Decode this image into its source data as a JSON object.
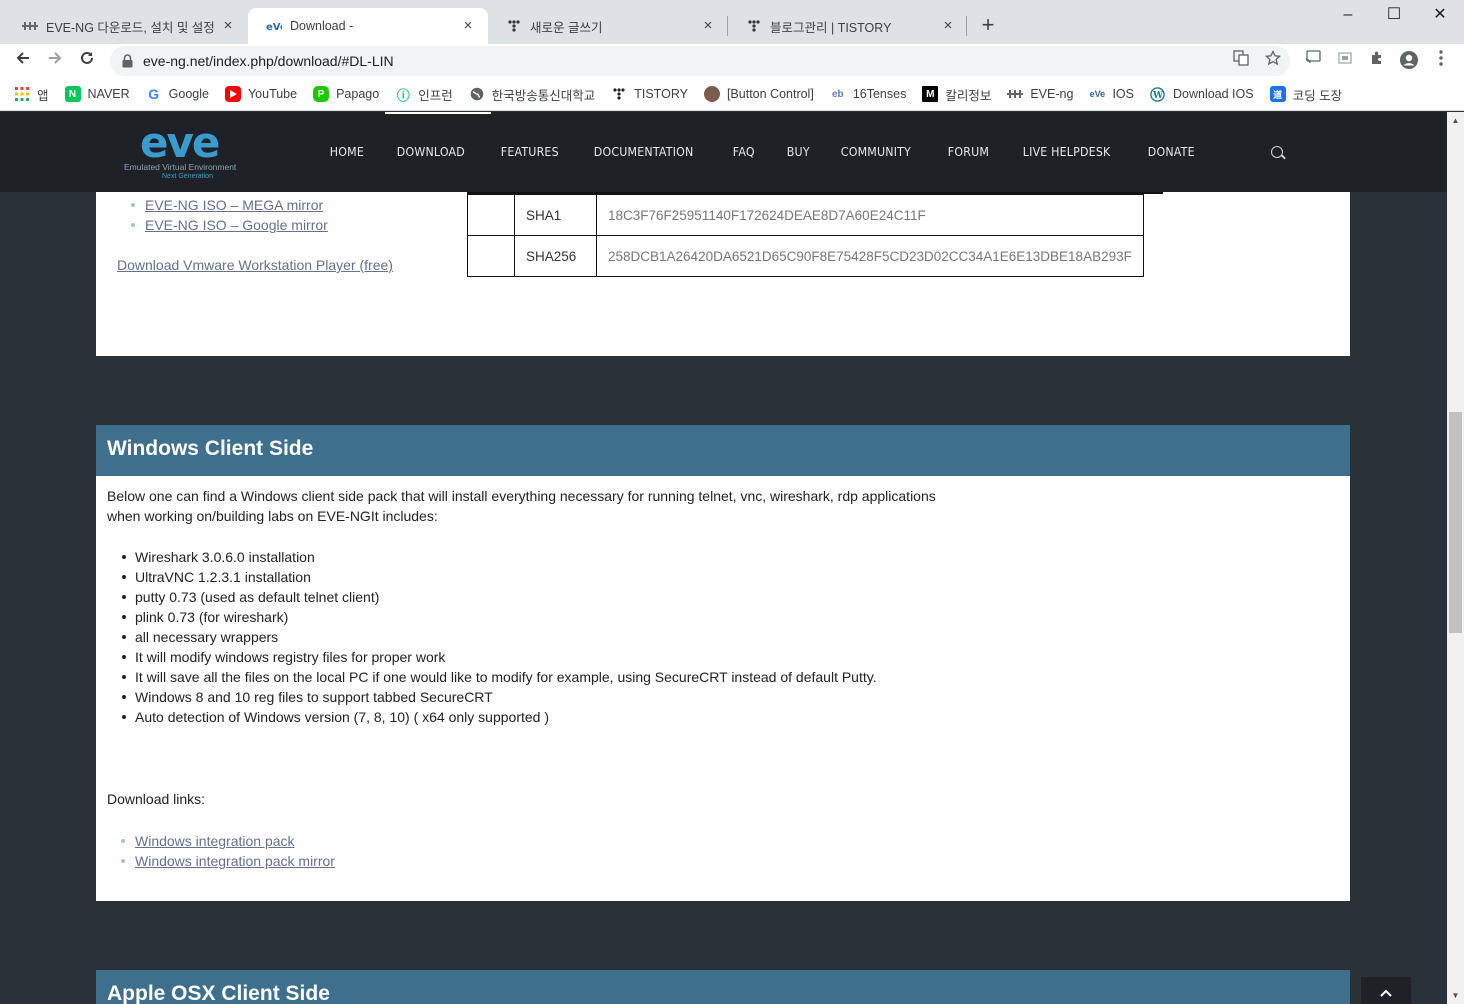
{
  "browser": {
    "tabs": [
      {
        "title": "EVE-NG 다운로드, 설치 및 설정",
        "close": "×"
      },
      {
        "title": "Download -",
        "close": "×"
      },
      {
        "title": "새로운 글쓰기",
        "close": "×"
      },
      {
        "title": "블로그관리 | TISTORY",
        "close": "×"
      }
    ],
    "newtab": "+",
    "window": {
      "minimize": "–",
      "maximize": "☐",
      "close": "✕"
    },
    "url": "eve-ng.net/index.php/download/#DL-LIN",
    "bookmarks": [
      {
        "label": "앱",
        "icon": "apps-grid-icon",
        "color": "#e8453c"
      },
      {
        "label": "NAVER",
        "icon": "naver-icon",
        "color": "#03c75a"
      },
      {
        "label": "Google",
        "icon": "google-icon",
        "color": "#4285f4"
      },
      {
        "label": "YouTube",
        "icon": "youtube-icon",
        "color": "#ff0000"
      },
      {
        "label": "Papago",
        "icon": "papago-icon",
        "color": "#1ec800"
      },
      {
        "label": "인프런",
        "icon": "inflearn-icon",
        "color": "#1dc078"
      },
      {
        "label": "한국방송통신대학교",
        "icon": "globe-icon",
        "color": "#5f6368"
      },
      {
        "label": "TISTORY",
        "icon": "tistory-icon",
        "color": "#202124"
      },
      {
        "label": "[Button Control]",
        "icon": "avatar-icon",
        "color": "#7a5c4f"
      },
      {
        "label": "16Tenses",
        "icon": "eb-icon",
        "color": "#5b7fbd"
      },
      {
        "label": "칼리정보",
        "icon": "medium-icon",
        "color": "#000000"
      },
      {
        "label": "EVE-ng",
        "icon": "eve-icon",
        "color": "#5f6368"
      },
      {
        "label": "IOS",
        "icon": "eve-ng-icon",
        "color": "#2c6aa0"
      },
      {
        "label": "Download IOS",
        "icon": "wordpress-icon",
        "color": "#21759b"
      },
      {
        "label": "코딩 도장",
        "icon": "dojang-icon",
        "color": "#1a73e8"
      }
    ]
  },
  "site": {
    "logo_text": "eve",
    "logo_sub1": "Emulated Virtual Environment",
    "logo_sub2": "Next Generation",
    "nav": [
      "HOME",
      "DOWNLOAD",
      "FEATURES",
      "DOCUMENTATION",
      "FAQ",
      "BUY",
      "COMMUNITY",
      "FORUM",
      "LIVE HELPDESK",
      "DONATE"
    ]
  },
  "iso_links": [
    "EVE-NG ISO – MEGA mirror",
    "EVE-NG ISO – Google mirror"
  ],
  "vmware_link": "Download Vmware Workstation Player (free)",
  "hashes": [
    {
      "algo": "SHA1",
      "value": "18C3F76F25951140F172624DEAE8D7A60E24C11F"
    },
    {
      "algo": "SHA256",
      "value": "258DCB1A26420DA6521D65C90F8E75428F5CD23D02CC34A1E6E13DBE18AB293F"
    }
  ],
  "windows": {
    "heading": "Windows Client Side",
    "intro1": "Below one can find a Windows client side pack that will install everything necessary for running telnet, vnc, wireshark, rdp applications",
    "intro2": "when working on/building labs on EVE-NGIt includes:",
    "features": [
      "Wireshark 3.0.6.0  installation",
      "UltraVNC 1.2.3.1  installation",
      "putty 0.73 (used as default telnet client)",
      "plink 0.73 (for wireshark)",
      "all necessary wrappers",
      "It will modify windows registry files for proper work",
      "It will save all the files on the local PC if one would like to modify for example, using SecureCRT instead of default Putty.",
      "Windows 8 and 10 reg files to support tabbed SecureCRT",
      "Auto detection of Windows version (7, 8, 10) ( x64 only supported )"
    ],
    "download_label": "Download links:",
    "links": [
      "Windows integration pack",
      "Windows integration pack mirror"
    ]
  },
  "apple": {
    "heading": "Apple OSX Client Side"
  }
}
